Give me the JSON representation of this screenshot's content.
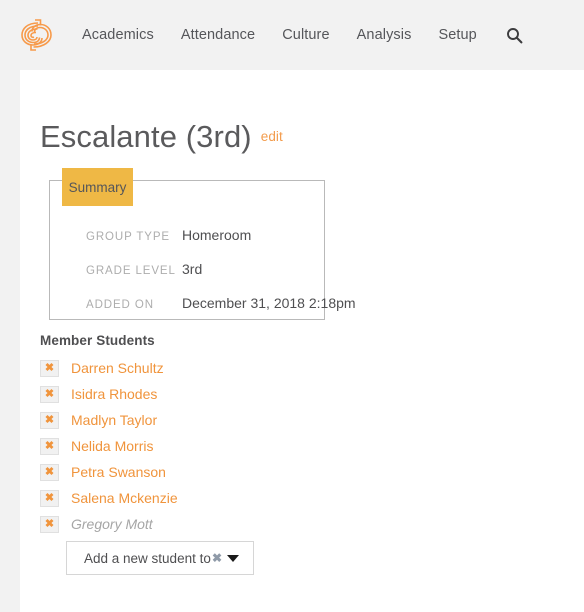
{
  "nav": {
    "logo_icon": "spiral-logo-icon",
    "items": [
      {
        "label": "Academics"
      },
      {
        "label": "Attendance"
      },
      {
        "label": "Culture"
      },
      {
        "label": "Analysis"
      },
      {
        "label": "Setup"
      }
    ],
    "search_icon": "search-icon"
  },
  "page": {
    "title": "Escalante (3rd)",
    "edit_label": "edit"
  },
  "summary": {
    "tab_label": "Summary",
    "rows": [
      {
        "label": "GROUP TYPE",
        "value": "Homeroom"
      },
      {
        "label": "GRADE LEVEL",
        "value": "3rd"
      },
      {
        "label": "ADDED ON",
        "value": "December 31, 2018 2:18pm"
      }
    ]
  },
  "members": {
    "heading": "Member Students",
    "remove_glyph": "✖",
    "students": [
      {
        "name": "Darren Schultz",
        "inactive": false
      },
      {
        "name": "Isidra Rhodes",
        "inactive": false
      },
      {
        "name": "Madlyn Taylor",
        "inactive": false
      },
      {
        "name": "Nelida Morris",
        "inactive": false
      },
      {
        "name": "Petra Swanson",
        "inactive": false
      },
      {
        "name": "Salena Mckenzie",
        "inactive": false
      },
      {
        "name": "Gregory Mott",
        "inactive": true
      }
    ]
  },
  "add_student": {
    "label": "Add a new student to",
    "clear_glyph": "✖",
    "caret_icon": "chevron-down-icon"
  },
  "colors": {
    "brand_orange": "#f0943c",
    "tab_gold": "#efb845",
    "page_bg": "#f2f2f2",
    "text_dark": "#4f4f51",
    "text_muted": "#adadad"
  }
}
